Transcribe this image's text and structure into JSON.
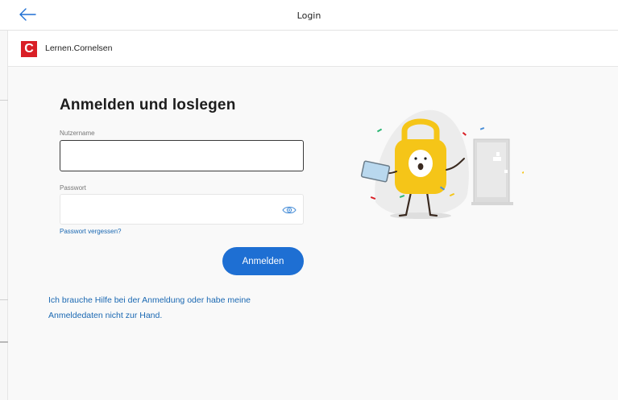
{
  "topbar": {
    "title": "Login",
    "back_icon": "arrow-left-icon"
  },
  "brand": {
    "logo_letter": "C",
    "name": "Lernen.Cornelsen",
    "color": "#d91f26"
  },
  "login": {
    "heading": "Anmelden und loslegen",
    "username_label": "Nutzername",
    "username_value": "",
    "password_label": "Passwort",
    "password_value": "",
    "show_password_icon": "eye-icon",
    "forgot_password": "Passwort vergessen?",
    "submit_label": "Anmelden",
    "help_text": "Ich brauche Hilfe bei der Anmeldung oder habe meine Anmeldedaten nicht zur Hand."
  },
  "colors": {
    "primary": "#1e6fd3",
    "link": "#1a68b2",
    "mascot_yellow": "#f5c518"
  }
}
